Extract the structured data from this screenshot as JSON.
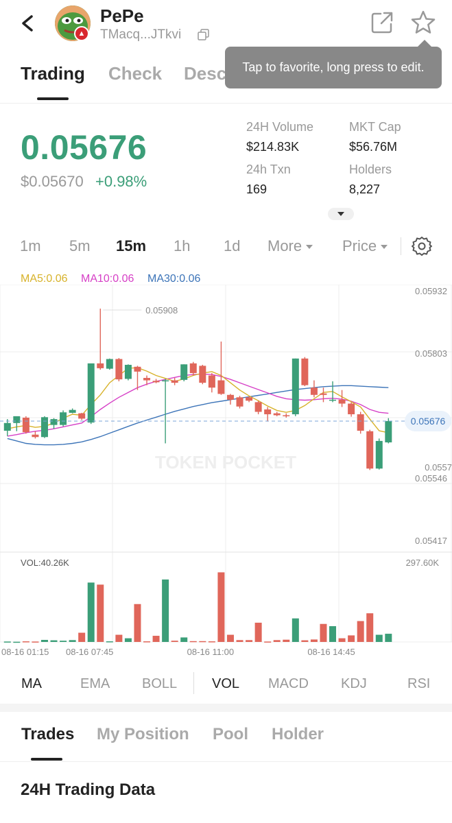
{
  "header": {
    "token_name": "PePe",
    "token_address": "TMacq...JTkvi",
    "tooltip": "Tap to favorite, long press to edit."
  },
  "tabs": [
    {
      "label": "Trading",
      "active": true
    },
    {
      "label": "Check",
      "active": false
    },
    {
      "label": "Desc",
      "active": false
    }
  ],
  "price": {
    "current": "0.05676",
    "usd": "$0.05670",
    "change": "+0.98%"
  },
  "stats": [
    {
      "label": "24H Volume",
      "value": "$214.83K"
    },
    {
      "label": "MKT Cap",
      "value": "$56.76M"
    },
    {
      "label": "24h Txn",
      "value": "169"
    },
    {
      "label": "Holders",
      "value": "8,227"
    }
  ],
  "timeframes": [
    {
      "label": "1m",
      "active": false
    },
    {
      "label": "5m",
      "active": false
    },
    {
      "label": "15m",
      "active": true
    },
    {
      "label": "1h",
      "active": false
    },
    {
      "label": "1d",
      "active": false
    },
    {
      "label": "More",
      "active": false
    },
    {
      "label": "Price",
      "active": false
    }
  ],
  "ma_legend": [
    {
      "label": "MA5:0.06",
      "color": "#d7b22a"
    },
    {
      "label": "MA10:0.06",
      "color": "#d63fc6"
    },
    {
      "label": "MA30:0.06",
      "color": "#3c74b8"
    }
  ],
  "colors": {
    "up": "#3b9e78",
    "down": "#e0665a",
    "accent_green": "#3b9e78"
  },
  "chart_data": {
    "type": "candlestick",
    "interval": "15m",
    "price_axis_labels": [
      "0.05932",
      "0.05803",
      "0.05676",
      "0.05546",
      "0.05417"
    ],
    "price_axis_extra_label": "0.0557",
    "price_range": [
      0.05417,
      0.05932
    ],
    "high_marker": "0.05908",
    "current_price_label": "0.05676",
    "watermark": "TOKEN POCKET",
    "volume_label": "VOL:40.26K",
    "volume_max_label": "297.60K",
    "volume_max": 297.6,
    "x_labels": [
      "08-16 01:15",
      "08-16 07:45",
      "08-16 11:00",
      "08-16 14:45"
    ],
    "x_label_indices": [
      0,
      9,
      22,
      35
    ],
    "candles": [
      {
        "o": 0.05656,
        "h": 0.0568,
        "l": 0.05645,
        "c": 0.05672
      },
      {
        "o": 0.05672,
        "h": 0.05685,
        "l": 0.05655,
        "c": 0.05686
      },
      {
        "o": 0.05683,
        "h": 0.05686,
        "l": 0.0565,
        "c": 0.05653
      },
      {
        "o": 0.05648,
        "h": 0.05655,
        "l": 0.0564,
        "c": 0.05643
      },
      {
        "o": 0.05643,
        "h": 0.05686,
        "l": 0.05641,
        "c": 0.05684
      },
      {
        "o": 0.05668,
        "h": 0.05682,
        "l": 0.0566,
        "c": 0.0568
      },
      {
        "o": 0.05668,
        "h": 0.05698,
        "l": 0.05665,
        "c": 0.05694
      },
      {
        "o": 0.05693,
        "h": 0.05702,
        "l": 0.05692,
        "c": 0.05699
      },
      {
        "o": 0.05692,
        "h": 0.05693,
        "l": 0.05678,
        "c": 0.05681
      },
      {
        "o": 0.05673,
        "h": 0.057,
        "l": 0.0567,
        "c": 0.05795
      },
      {
        "o": 0.05795,
        "h": 0.05908,
        "l": 0.05782,
        "c": 0.05785
      },
      {
        "o": 0.05784,
        "h": 0.05805,
        "l": 0.05782,
        "c": 0.05804
      },
      {
        "o": 0.05804,
        "h": 0.05806,
        "l": 0.05758,
        "c": 0.05762
      },
      {
        "o": 0.05763,
        "h": 0.05793,
        "l": 0.0576,
        "c": 0.05792
      },
      {
        "o": 0.05788,
        "h": 0.0579,
        "l": 0.0574,
        "c": 0.05778
      },
      {
        "o": 0.05765,
        "h": 0.0577,
        "l": 0.0575,
        "c": 0.0576
      },
      {
        "o": 0.05759,
        "h": 0.05763,
        "l": 0.05754,
        "c": 0.05756
      },
      {
        "o": 0.05759,
        "h": 0.05763,
        "l": 0.0563,
        "c": 0.0576
      },
      {
        "o": 0.0576,
        "h": 0.05765,
        "l": 0.0575,
        "c": 0.05755
      },
      {
        "o": 0.05761,
        "h": 0.05793,
        "l": 0.05758,
        "c": 0.05793
      },
      {
        "o": 0.05795,
        "h": 0.05798,
        "l": 0.0577,
        "c": 0.05775
      },
      {
        "o": 0.0579,
        "h": 0.05792,
        "l": 0.05752,
        "c": 0.05755
      },
      {
        "o": 0.0577,
        "h": 0.05775,
        "l": 0.05735,
        "c": 0.05745
      },
      {
        "o": 0.0576,
        "h": 0.0584,
        "l": 0.0573,
        "c": 0.05732
      },
      {
        "o": 0.0573,
        "h": 0.05732,
        "l": 0.0571,
        "c": 0.0572
      },
      {
        "o": 0.05725,
        "h": 0.05728,
        "l": 0.05702,
        "c": 0.05706
      },
      {
        "o": 0.05725,
        "h": 0.05727,
        "l": 0.05715,
        "c": 0.05718
      },
      {
        "o": 0.05715,
        "h": 0.05718,
        "l": 0.0569,
        "c": 0.05695
      },
      {
        "o": 0.057,
        "h": 0.05705,
        "l": 0.05675,
        "c": 0.0569
      },
      {
        "o": 0.05692,
        "h": 0.05695,
        "l": 0.05686,
        "c": 0.05688
      },
      {
        "o": 0.05688,
        "h": 0.05692,
        "l": 0.05683,
        "c": 0.05686
      },
      {
        "o": 0.0569,
        "h": 0.05805,
        "l": 0.05686,
        "c": 0.05805
      },
      {
        "o": 0.05805,
        "h": 0.05808,
        "l": 0.05748,
        "c": 0.0575
      },
      {
        "o": 0.05745,
        "h": 0.0576,
        "l": 0.05725,
        "c": 0.0573
      },
      {
        "o": 0.05733,
        "h": 0.05745,
        "l": 0.05715,
        "c": 0.0573
      },
      {
        "o": 0.0572,
        "h": 0.05758,
        "l": 0.05715,
        "c": 0.0572
      },
      {
        "o": 0.0572,
        "h": 0.0574,
        "l": 0.05705,
        "c": 0.05712
      },
      {
        "o": 0.05712,
        "h": 0.05715,
        "l": 0.05685,
        "c": 0.0569
      },
      {
        "o": 0.0569,
        "h": 0.05695,
        "l": 0.0565,
        "c": 0.05656
      },
      {
        "o": 0.05655,
        "h": 0.05658,
        "l": 0.05575,
        "c": 0.05578
      },
      {
        "o": 0.05578,
        "h": 0.0564,
        "l": 0.05576,
        "c": 0.05635
      },
      {
        "o": 0.05632,
        "h": 0.05682,
        "l": 0.0563,
        "c": 0.05676
      }
    ],
    "volumes": [
      2,
      1,
      3,
      2,
      10,
      8,
      6,
      9,
      45,
      290,
      280,
      3,
      35,
      18,
      185,
      3,
      30,
      305,
      6,
      22,
      4,
      4,
      3,
      340,
      35,
      9,
      9,
      94,
      2,
      9,
      11,
      115,
      8,
      12,
      88,
      77,
      18,
      32,
      102,
      140,
      35,
      40
    ],
    "ma5": [
      0.0566,
      0.05664,
      0.05667,
      0.05663,
      0.05665,
      0.05672,
      0.05682,
      0.0569,
      0.05688,
      0.0571,
      0.0573,
      0.05755,
      0.0577,
      0.05785,
      0.05786,
      0.05779,
      0.0577,
      0.05764,
      0.05758,
      0.05763,
      0.0577,
      0.05775,
      0.05778,
      0.0577,
      0.05755,
      0.0574,
      0.05728,
      0.05718,
      0.05707,
      0.05698,
      0.05694,
      0.05698,
      0.05708,
      0.05722,
      0.05735,
      0.05737,
      0.05726,
      0.05716,
      0.05705,
      0.0568,
      0.05656,
      0.05652
    ],
    "ma10": [
      0.05645,
      0.05648,
      0.05652,
      0.05655,
      0.05657,
      0.0566,
      0.05664,
      0.05668,
      0.05672,
      0.05685,
      0.057,
      0.05713,
      0.05725,
      0.05735,
      0.05745,
      0.05752,
      0.05758,
      0.05762,
      0.05766,
      0.0577,
      0.05772,
      0.05773,
      0.05772,
      0.05768,
      0.05762,
      0.05755,
      0.05748,
      0.05741,
      0.05734,
      0.05727,
      0.05722,
      0.0572,
      0.05719,
      0.0572,
      0.05722,
      0.05723,
      0.05721,
      0.05717,
      0.0571,
      0.057,
      0.05694,
      0.05692
    ],
    "ma30": [
      0.0564,
      0.05635,
      0.0563,
      0.05628,
      0.05627,
      0.05627,
      0.05628,
      0.0563,
      0.05633,
      0.05638,
      0.05644,
      0.05651,
      0.05658,
      0.05665,
      0.05672,
      0.05678,
      0.05684,
      0.0569,
      0.05696,
      0.05701,
      0.05706,
      0.0571,
      0.05714,
      0.05717,
      0.0572,
      0.05723,
      0.05726,
      0.05729,
      0.05732,
      0.05735,
      0.05738,
      0.05741,
      0.05743,
      0.05745,
      0.05747,
      0.05748,
      0.05749,
      0.05749,
      0.05748,
      0.05747,
      0.05746,
      0.05745
    ]
  },
  "indicators": [
    {
      "label": "MA",
      "active": true
    },
    {
      "label": "EMA",
      "active": false
    },
    {
      "label": "BOLL",
      "active": false
    },
    {
      "label": "VOL",
      "active": true
    },
    {
      "label": "MACD",
      "active": false
    },
    {
      "label": "KDJ",
      "active": false
    },
    {
      "label": "RSI",
      "active": false
    }
  ],
  "bottom_tabs": [
    {
      "label": "Trades",
      "active": true
    },
    {
      "label": "My Position",
      "active": false
    },
    {
      "label": "Pool",
      "active": false
    },
    {
      "label": "Holder",
      "active": false
    }
  ],
  "section_title": "24H Trading Data"
}
